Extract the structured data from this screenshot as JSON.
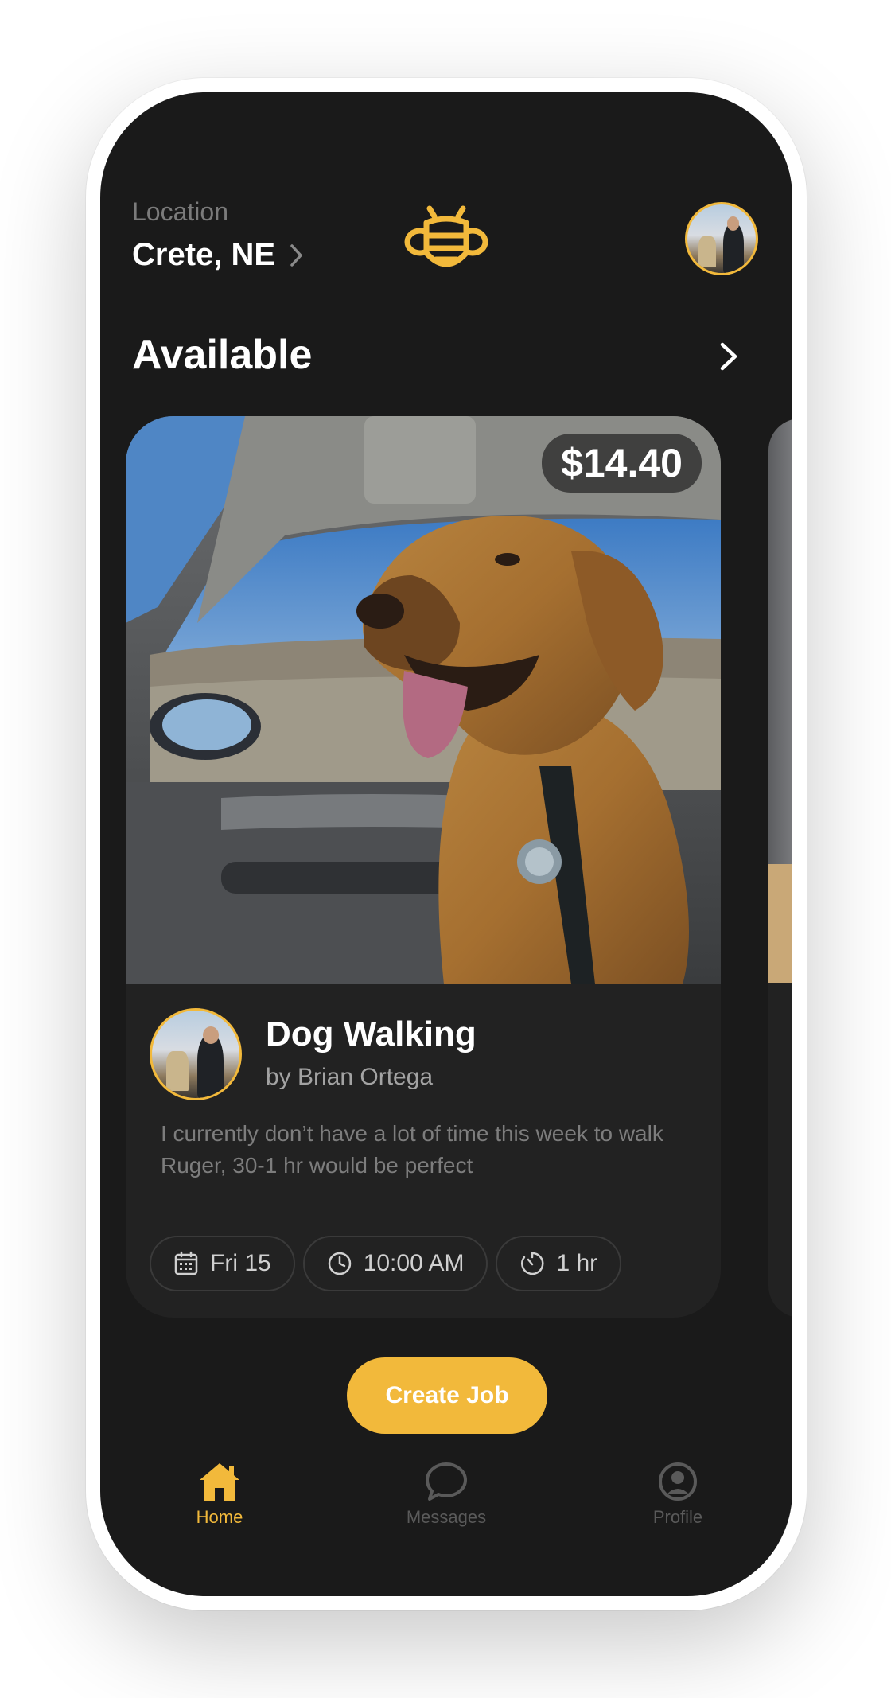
{
  "header": {
    "location_label": "Location",
    "location_value": "Crete, NE",
    "logo_icon": "bee-logo-icon",
    "avatar_icon": "user-avatar"
  },
  "section": {
    "title": "Available",
    "more_icon": "chevron-right-icon"
  },
  "job_card": {
    "price": "$14.40",
    "title": "Dog Walking",
    "author": "by Brian Ortega",
    "description": "I currently don’t have a lot of time this week to walk Ruger, 30-1 hr would be perfect",
    "chips": {
      "date": "Fri 15",
      "time": "10:00 AM",
      "duration": "1 hr"
    }
  },
  "create_button": {
    "label": "Create Job"
  },
  "tab_bar": {
    "home": "Home",
    "messages": "Messages",
    "profile": "Profile",
    "active": "Home"
  },
  "colors": {
    "accent": "#f2b93b",
    "background": "#1a1a1a",
    "card": "#222222",
    "text_primary": "#ffffff",
    "text_muted": "#7d7d7d"
  }
}
